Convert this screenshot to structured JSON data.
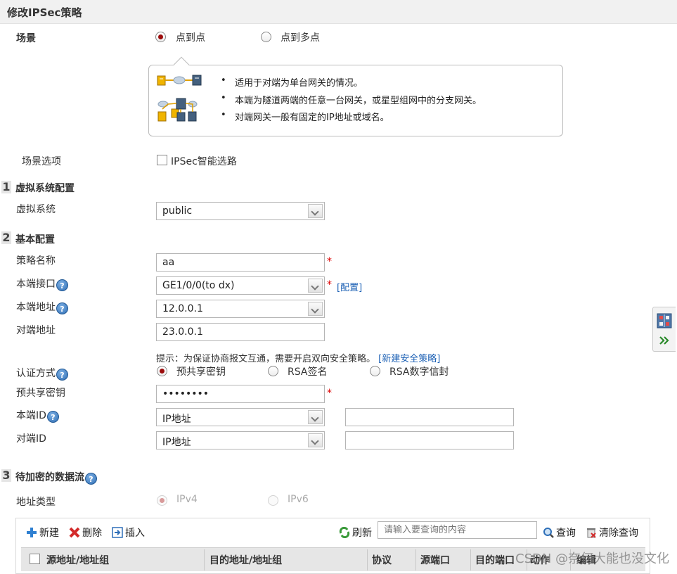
{
  "page_title": "修改IPSec策略",
  "scenario": {
    "label": "场景",
    "options": [
      {
        "label": "点到点",
        "selected": true
      },
      {
        "label": "点到多点",
        "selected": false
      }
    ],
    "info_bullets": [
      "适用于对端为单台网关的情况。",
      "本端为隧道两端的任意一台网关，或星型组网中的分支网关。",
      "对端网关一般有固定的IP地址或域名。"
    ],
    "option_label": "场景选项",
    "smart_route_label": "IPSec智能选路",
    "smart_route_checked": false
  },
  "section1": {
    "number": "1",
    "title": "虚拟系统配置",
    "vsys_label": "虚拟系统",
    "vsys_value": "public"
  },
  "section2": {
    "number": "2",
    "title": "基本配置",
    "policy_name_label": "策略名称",
    "policy_name_value": "aa",
    "local_if_label": "本端接口",
    "local_if_value": "GE1/0/0(to dx)",
    "config_link": "[配置]",
    "local_addr_label": "本端地址",
    "local_addr_value": "12.0.0.1",
    "peer_addr_label": "对端地址",
    "peer_addr_value": "23.0.0.1",
    "hint": "提示：为保证协商报文互通，需要开启双向安全策略。",
    "new_policy_link": "[新建安全策略]",
    "auth_label": "认证方式",
    "auth_options": [
      {
        "label": "预共享密钥",
        "selected": true
      },
      {
        "label": "RSA签名",
        "selected": false
      },
      {
        "label": "RSA数字信封",
        "selected": false
      }
    ],
    "psk_label": "预共享密钥",
    "psk_value": "••••••••",
    "local_id_label": "本端ID",
    "local_id_type": "IP地址",
    "local_id_value": "",
    "peer_id_label": "对端ID",
    "peer_id_type": "IP地址",
    "peer_id_value": "",
    "required_mark": "*",
    "help_mark": "?"
  },
  "section3": {
    "number": "3",
    "title": "待加密的数据流",
    "addr_type_label": "地址类型",
    "addr_type_options": [
      {
        "label": "IPv4",
        "selected": true,
        "disabled": true
      },
      {
        "label": "IPv6",
        "selected": false,
        "disabled": true
      }
    ]
  },
  "toolbar": {
    "new_label": "新建",
    "delete_label": "删除",
    "insert_label": "插入",
    "refresh_label": "刷新",
    "search_placeholder": "请输入要查询的内容",
    "search_label": "查询",
    "clear_label": "清除查询"
  },
  "table": {
    "columns": [
      "源地址/地址组",
      "目的地址/地址组",
      "协议",
      "源端口",
      "目的端口",
      "动作",
      "编辑"
    ]
  },
  "watermark": "CSDN @奈何大能也没文化",
  "colors": {
    "radio_selected": "#9c0c0c",
    "link": "#1a5fb4",
    "required": "#dd0000"
  }
}
